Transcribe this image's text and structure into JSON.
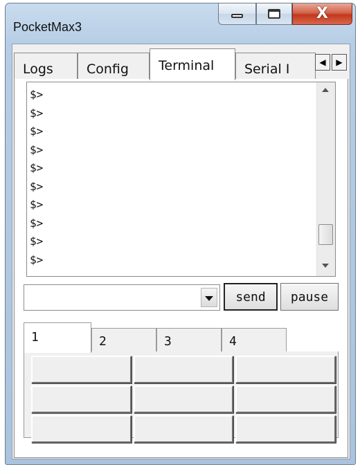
{
  "window": {
    "title": "PocketMax3"
  },
  "tabs": [
    {
      "label": "Logs",
      "active": false
    },
    {
      "label": "Config",
      "active": false
    },
    {
      "label": "Terminal",
      "active": true
    },
    {
      "label": "Serial I",
      "active": false
    }
  ],
  "tab_scroll": {
    "left": "◀",
    "right": "▶"
  },
  "terminal": {
    "lines": [
      "$>",
      "$>",
      "$>",
      "$>",
      "$>",
      "$>",
      "$>",
      "$>",
      "$>",
      "$>"
    ]
  },
  "command": {
    "value": "",
    "placeholder": ""
  },
  "buttons": {
    "send": "send",
    "pause": "pause"
  },
  "subtabs": [
    {
      "label": "1",
      "active": true
    },
    {
      "label": "2",
      "active": false
    },
    {
      "label": "3",
      "active": false
    },
    {
      "label": "4",
      "active": false
    }
  ],
  "macro_buttons": [
    "",
    "",
    "",
    "",
    "",
    "",
    "",
    "",
    ""
  ],
  "colors": {
    "close": "#c2381c",
    "title_bg": "#b6cde5"
  }
}
